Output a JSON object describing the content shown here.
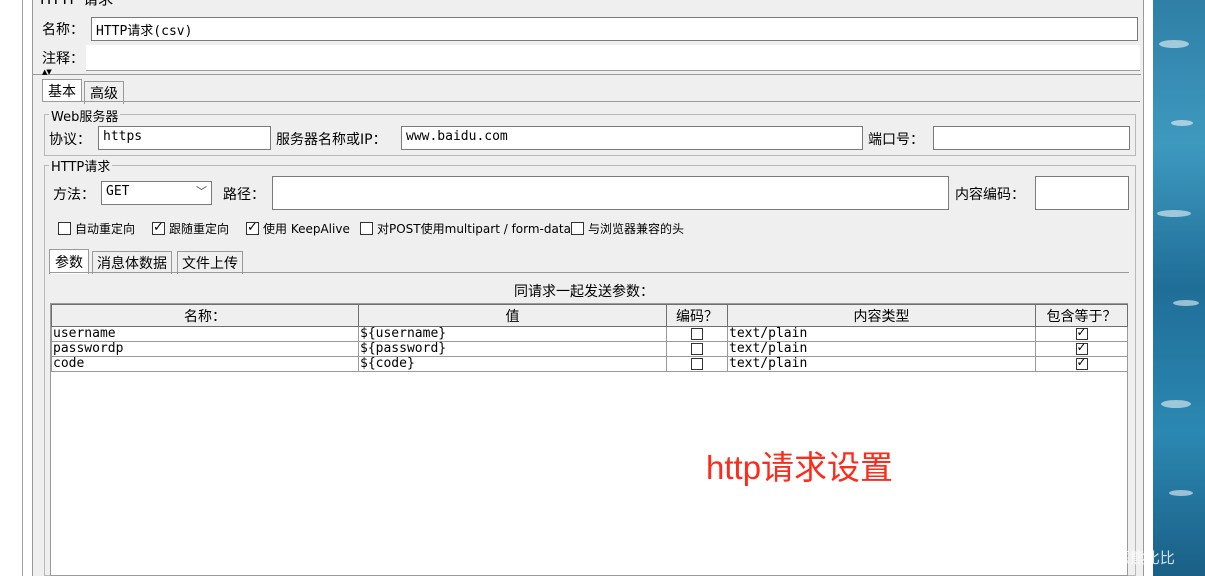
{
  "window": {
    "title_fragment": "HTTP 请求"
  },
  "name_row": {
    "label": "名称：",
    "value": "HTTP请求(csv)"
  },
  "comment_row": {
    "label": "注释：",
    "value": ""
  },
  "collapse_arrows": "▲▼",
  "top_tabs": [
    {
      "label": "基本",
      "active": true
    },
    {
      "label": "高级",
      "active": false
    }
  ],
  "web_server": {
    "legend": "Web服务器",
    "protocol_label": "协议：",
    "protocol_value": "https",
    "server_label": "服务器名称或IP：",
    "server_value": "www.baidu.com",
    "port_label": "端口号：",
    "port_value": ""
  },
  "http_request": {
    "legend": "HTTP请求",
    "method_label": "方法：",
    "method_value": "GET",
    "path_label": "路径：",
    "path_value": "",
    "encoding_label": "内容编码：",
    "encoding_value": ""
  },
  "options": [
    {
      "label": "自动重定向",
      "checked": false
    },
    {
      "label": "跟随重定向",
      "checked": true
    },
    {
      "label": "使用 KeepAlive",
      "checked": true
    },
    {
      "label": "对POST使用multipart / form-data",
      "checked": false
    },
    {
      "label": "与浏览器兼容的头",
      "checked": false
    }
  ],
  "sub_tabs": [
    {
      "label": "参数",
      "active": true
    },
    {
      "label": "消息体数据",
      "active": false
    },
    {
      "label": "文件上传",
      "active": false
    }
  ],
  "params_panel": {
    "caption": "同请求一起发送参数：",
    "columns": [
      "名称：",
      "值",
      "编码？",
      "内容类型",
      "包含等于？"
    ],
    "rows": [
      {
        "name": "username",
        "value": "${username}",
        "encode": false,
        "content_type": "text/plain",
        "include_equals": true
      },
      {
        "name": "passwordp",
        "value": "${password}",
        "encode": false,
        "content_type": "text/plain",
        "include_equals": true
      },
      {
        "name": "code",
        "value": "${code}",
        "encode": false,
        "content_type": "text/plain",
        "include_equals": true
      }
    ]
  },
  "annotation": {
    "text": "http请求设置",
    "color": "#ff2a1a"
  },
  "watermark": "CSDN @恶熊比比"
}
